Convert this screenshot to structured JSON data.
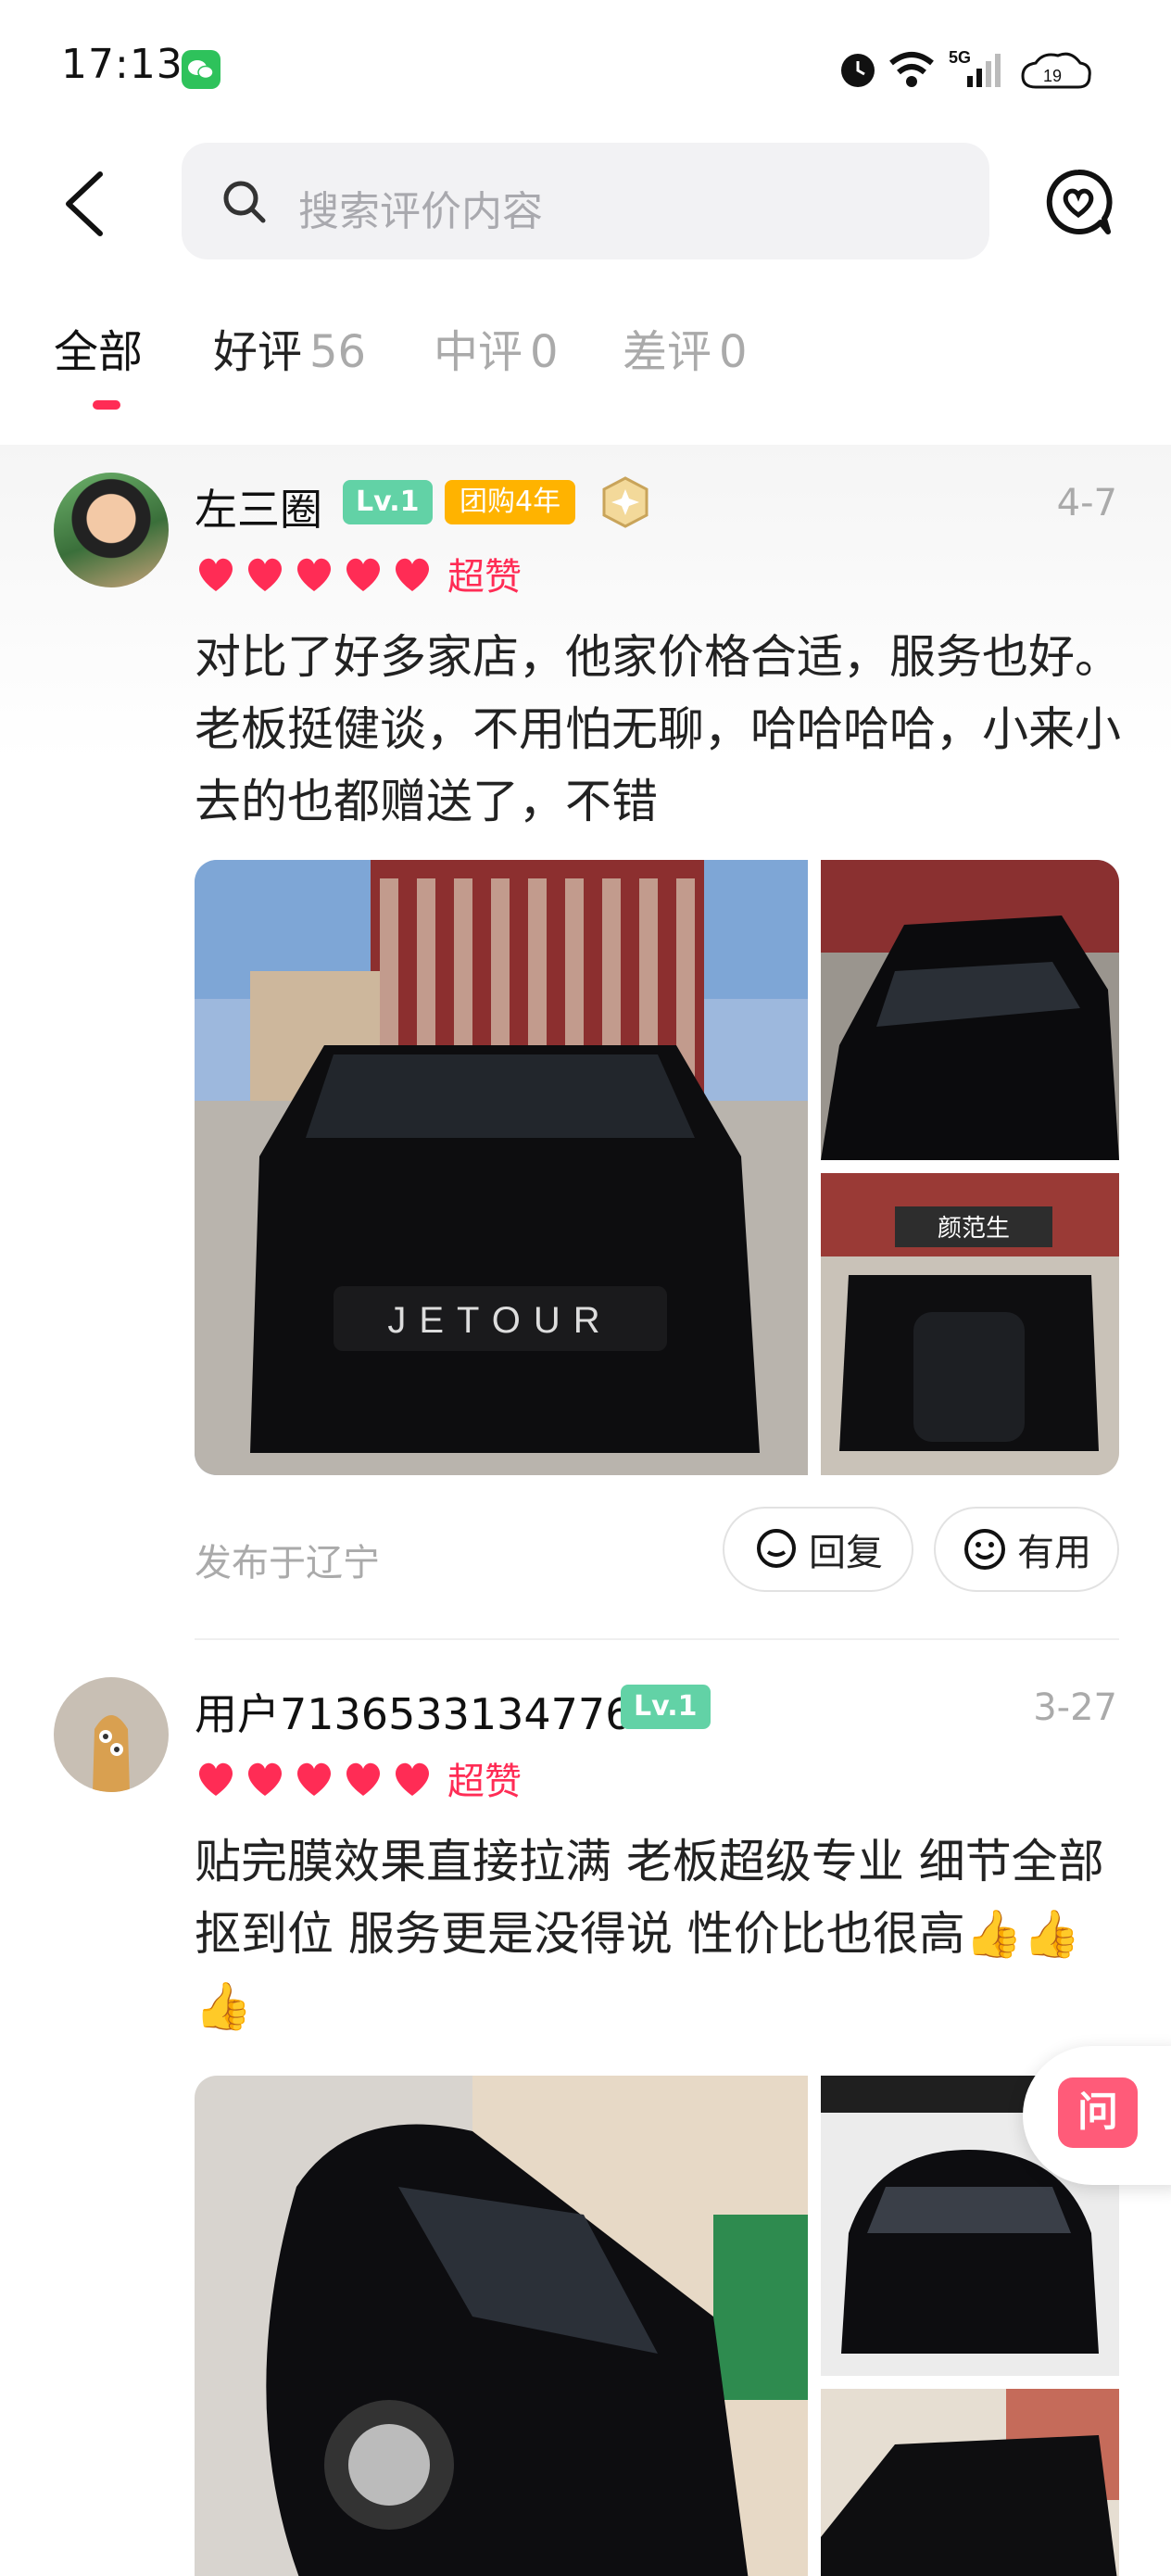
{
  "status_bar": {
    "time": "17:13",
    "network": "5G",
    "battery": "19"
  },
  "search": {
    "placeholder": "搜索评价内容"
  },
  "tabs": [
    {
      "label": "全部",
      "count": ""
    },
    {
      "label": "好评",
      "count": "56"
    },
    {
      "label": "中评",
      "count": "0"
    },
    {
      "label": "差评",
      "count": "0"
    }
  ],
  "reviews": [
    {
      "username": "左三圈",
      "level": "Lv.1",
      "tuangou_badge": "团购4年",
      "date": "4-7",
      "rating": 5,
      "rating_word": "超赞",
      "text": "对比了好多家店，他家价格合适，服务也好。老板挺健谈，不用怕无聊，哈哈哈哈，小来小去的也都赠送了，不错",
      "location": "发布于辽宁",
      "reply_label": "回复",
      "useful_label": "有用",
      "photo_text": {
        "grille": "JETOUR",
        "shop_sign": "颜范生"
      }
    },
    {
      "username": "用户7136533134776",
      "level": "Lv.1",
      "date": "3-27",
      "rating": 5,
      "rating_word": "超赞",
      "text": "贴完膜效果直接拉满 老板超级专业 细节全部抠到位 服务更是没得说 性价比也很高👍👍👍"
    }
  ],
  "floating": {
    "ask_label": "问"
  },
  "colors": {
    "accent": "#ff2c55",
    "level_badge": "#62d2a6",
    "tuangou_badge": "#ffb300",
    "muted_text": "#aaaaaa",
    "search_bg": "#f2f2f4"
  }
}
